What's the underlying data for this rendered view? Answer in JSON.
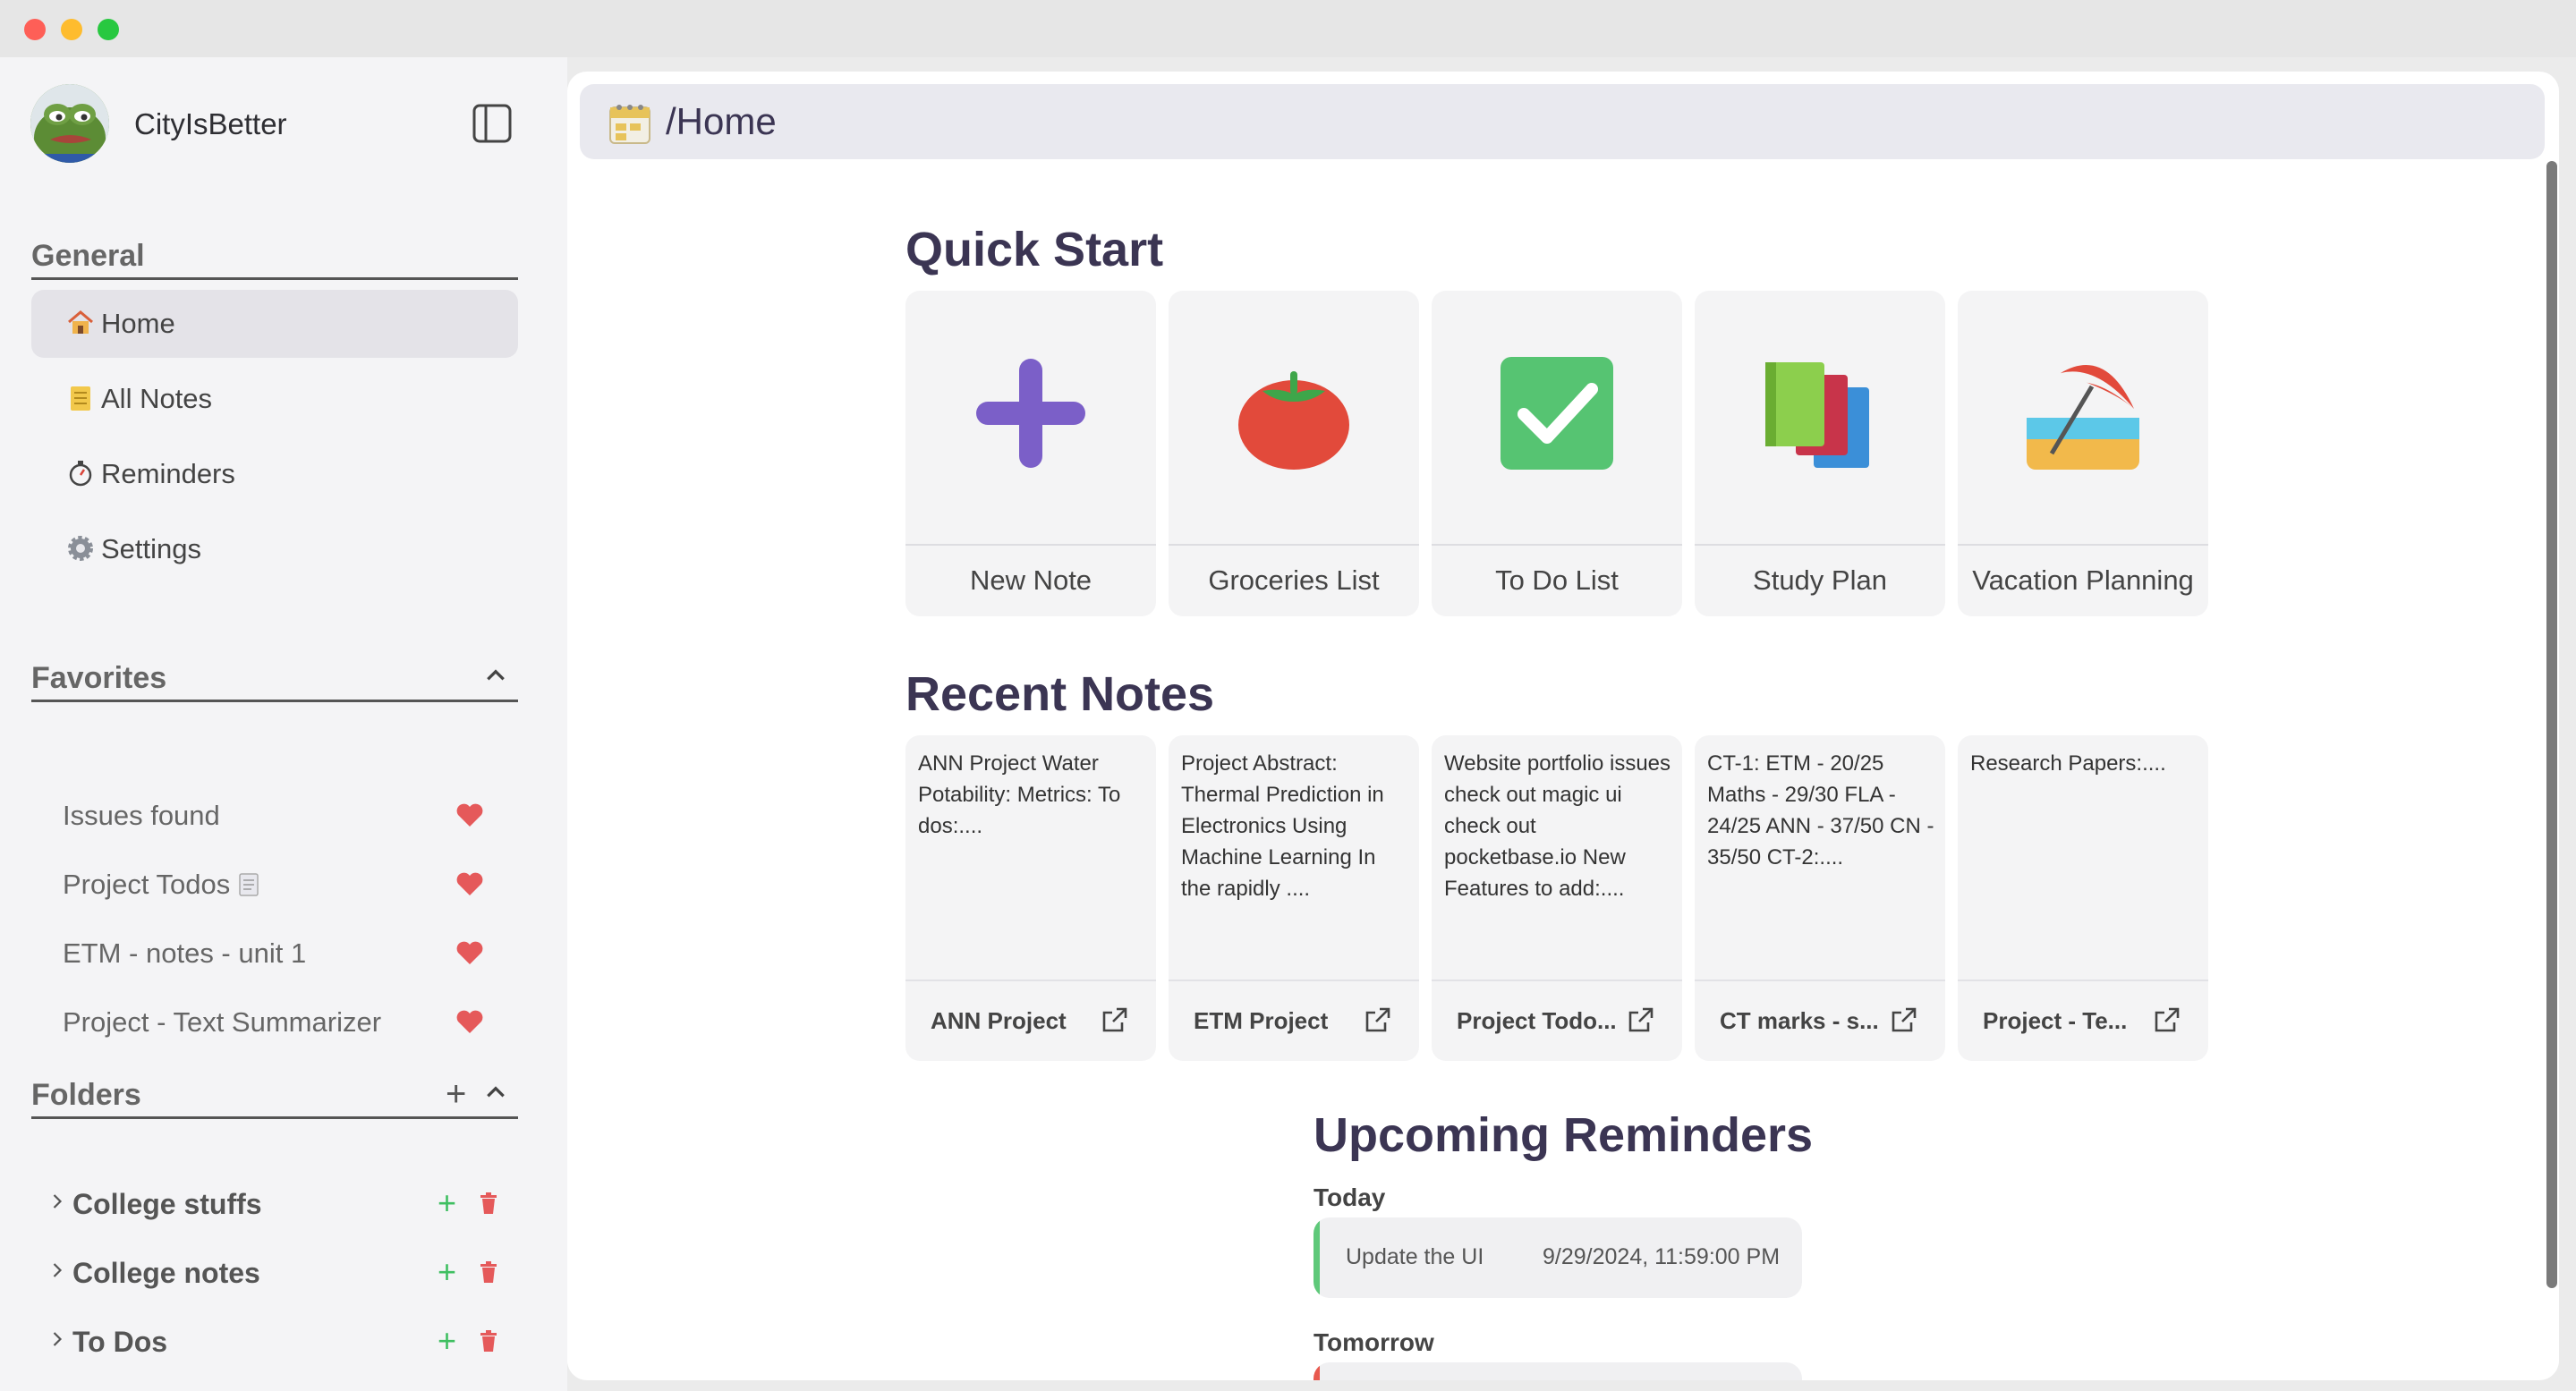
{
  "window": {
    "colors": {
      "red": "#fe5f57",
      "yellow": "#febc2e",
      "green": "#28c840"
    }
  },
  "sidebar": {
    "username": "CityIsBetter",
    "general": {
      "title": "General",
      "items": [
        {
          "label": "Home",
          "icon": "house-icon",
          "active": true
        },
        {
          "label": "All Notes",
          "icon": "notepad-icon"
        },
        {
          "label": "Reminders",
          "icon": "stopwatch-icon"
        },
        {
          "label": "Settings",
          "icon": "gear-icon"
        }
      ]
    },
    "favorites": {
      "title": "Favorites",
      "items": [
        {
          "label": "Issues found"
        },
        {
          "label": "Project Todos"
        },
        {
          "label": "ETM - notes - unit 1"
        },
        {
          "label": "Project - Text Summarizer"
        }
      ]
    },
    "folders": {
      "title": "Folders",
      "add": "+",
      "items": [
        {
          "label": "College stuffs"
        },
        {
          "label": "College notes"
        },
        {
          "label": "To Dos"
        }
      ]
    }
  },
  "main": {
    "path": "/Home",
    "quick_start": {
      "title": "Quick Start",
      "cards": [
        {
          "label": "New Note",
          "icon": "plus-icon"
        },
        {
          "label": "Groceries List",
          "icon": "tomato-icon"
        },
        {
          "label": "To Do List",
          "icon": "checkmark-icon"
        },
        {
          "label": "Study Plan",
          "icon": "books-icon"
        },
        {
          "label": "Vacation Planning",
          "icon": "beach-umbrella-icon"
        }
      ]
    },
    "recent_notes": {
      "title": "Recent Notes",
      "notes": [
        {
          "preview": "ANN Project Water Potability: Metrics: To dos:....",
          "title": "ANN Project"
        },
        {
          "preview": "Project Abstract: Thermal Prediction in Electronics Using Machine Learning In the rapidly ....",
          "title": "ETM Project"
        },
        {
          "preview": "Website portfolio issues check out magic ui check out pocketbase.io New Features to add:....",
          "title": "Project Todo..."
        },
        {
          "preview": "CT-1: ETM - 20/25 Maths - 29/30 FLA - 24/25 ANN - 37/50 CN - 35/50 CT-2:....",
          "title": "CT marks - s..."
        },
        {
          "preview": "Research Papers:....",
          "title": "Project - Te..."
        }
      ]
    },
    "reminders": {
      "title": "Upcoming Reminders",
      "groups": [
        {
          "day": "Today",
          "text": "Update the UI",
          "datetime": "9/29/2024, 11:59:00 PM",
          "color": "#5fc97a"
        },
        {
          "day": "Tomorrow",
          "text": "",
          "datetime": "",
          "color": "#e8594f"
        }
      ]
    }
  }
}
